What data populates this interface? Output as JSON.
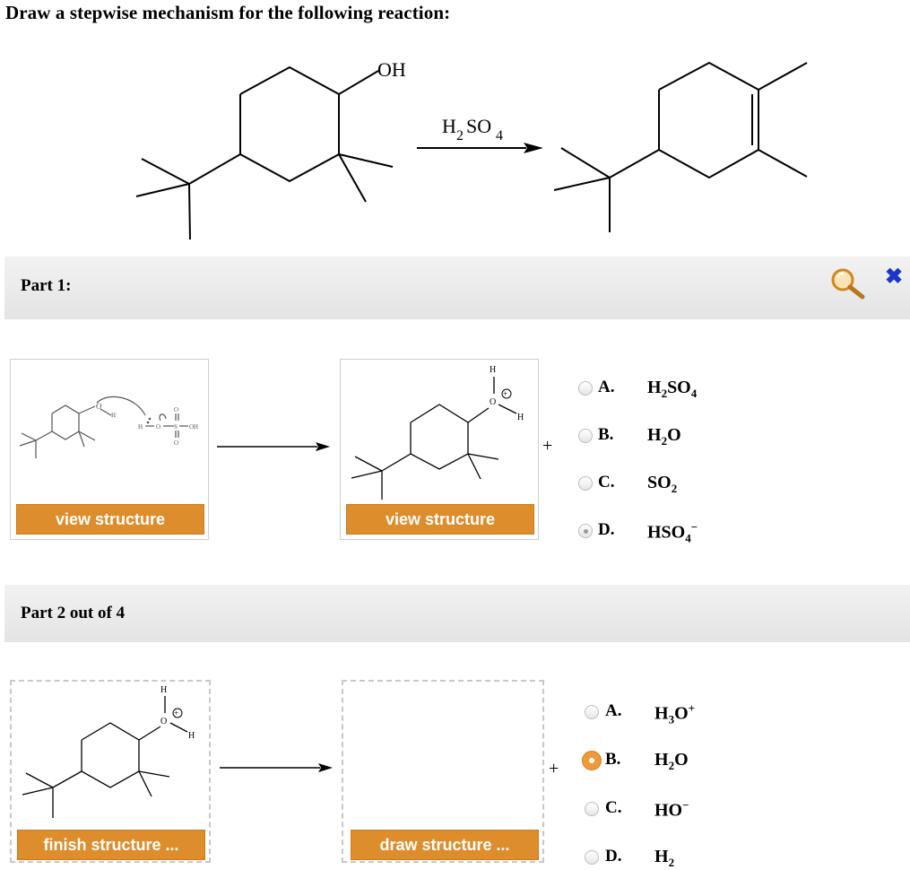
{
  "title": "Draw a stepwise mechanism for the following reaction:",
  "reaction": {
    "reagent_main": "H",
    "reagent_sub1": "2",
    "reagent_mid": "SO",
    "reagent_sub2": "4",
    "oh_label": "OH"
  },
  "part1": {
    "label": "Part 1:",
    "view_button_1": "view structure",
    "view_button_2": "view structure",
    "plus": "+",
    "options": [
      {
        "letter": "A.",
        "formula_html": "H<sub>2</sub>SO<sub>4</sub>"
      },
      {
        "letter": "B.",
        "formula_html": "H<sub>2</sub>O"
      },
      {
        "letter": "C.",
        "formula_html": "SO<sub>2</sub>"
      },
      {
        "letter": "D.",
        "formula_html": "HSO<sub>4</sub><sup>&minus;</sup>"
      }
    ],
    "selected": "D."
  },
  "part2": {
    "label": "Part 2 out of 4",
    "finish_button": "finish structure ...",
    "draw_button": "draw structure ...",
    "plus": "+",
    "options": [
      {
        "letter": "A.",
        "formula_html": "H<sub>3</sub>O<sup>+</sup>"
      },
      {
        "letter": "B.",
        "formula_html": "H<sub>2</sub>O"
      },
      {
        "letter": "C.",
        "formula_html": "HO<sup>&minus;</sup>"
      },
      {
        "letter": "D.",
        "formula_html": "H<sub>2</sub>"
      }
    ],
    "selected": "B."
  },
  "mini_labels": {
    "h": "H",
    "o": "O",
    "s": "S",
    "oh": "OH"
  },
  "icons": {
    "magnifier": "magnifier-icon",
    "close": "close-icon"
  },
  "colors": {
    "accent_orange": "#dd8d2b",
    "close_blue": "#1a35c8"
  }
}
